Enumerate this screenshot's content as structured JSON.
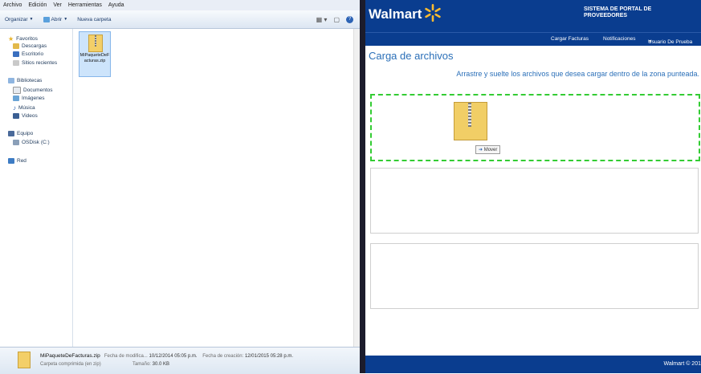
{
  "explorer": {
    "menu": [
      "Archivo",
      "Edición",
      "Ver",
      "Herramientas",
      "Ayuda"
    ],
    "toolbar": {
      "organize": "Organizar",
      "open": "Abrir",
      "new_folder": "Nueva carpeta"
    },
    "nav": {
      "favorites": "Favoritos",
      "downloads": "Descargas",
      "desktop": "Escritorio",
      "recent": "Sitios recientes",
      "libraries": "Bibliotecas",
      "documents": "Documentos",
      "images": "Imágenes",
      "music": "Música",
      "videos": "Videos",
      "computer": "Equipo",
      "osdisk": "OSDisk (C:)",
      "network": "Red"
    },
    "file": {
      "name": "MiPaqueteDeFacturas.zip"
    },
    "details": {
      "name": "MiPaqueteDeFacturas.zip",
      "modified_label": "Fecha de modifica...",
      "modified_value": "10/12/2014 05:05 p.m.",
      "created_label": "Fecha de creación:",
      "created_value": "12/01/2015 05:28 p.m.",
      "type": "Carpeta comprimida (en zip)",
      "size_label": "Tamaño:",
      "size_value": "30.0 KB"
    }
  },
  "portal": {
    "logo": "Walmart",
    "system_title": "SISTEMA DE PORTAL DE PROVEEDORES",
    "nav": {
      "invoices": "Cargar Facturas",
      "notifications": "Notificaciones",
      "user": "Usuario De Prueba"
    },
    "page_title": "Carga de archivos",
    "instruction": "Arrastre y suelte los archivos que desea cargar dentro de la zona punteada.",
    "move_label": "Mover",
    "footer": "Walmart © 201"
  }
}
